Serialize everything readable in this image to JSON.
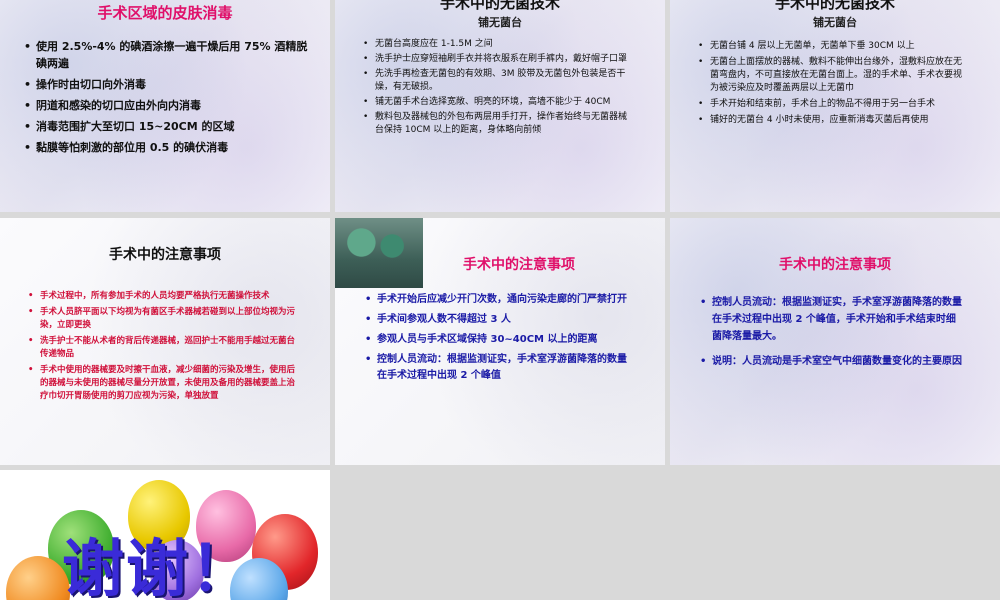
{
  "slide1": {
    "title": "手术区域的皮肤消毒",
    "bullets": [
      "使用 2.5%-4% 的碘酒涂擦一遍干燥后用 75% 酒精脱碘两遍",
      "操作时由切口向外消毒",
      "阴道和感染的切口应由外向内消毒",
      "消毒范围扩大至切口 15~20CM 的区域",
      "黏膜等怕刺激的部位用 0.5 的碘伏消毒"
    ]
  },
  "slide2": {
    "title": "手术中的无菌技术",
    "subtitle": "铺无菌台",
    "bullets": [
      "无菌台高度应在 1-1.5M 之间",
      "洗手护士应穿短袖刷手衣并将衣服系在刷手裤内，戴好帽子口罩",
      "先洗手再检查无菌包的有效期、3M 胶带及无菌包外包装是否干燥，有无破损。",
      "铺无菌手术台选择宽敞、明亮的环境，高墙不能少于 40CM",
      "敷料包及器械包的外包布两层用手打开，操作者始终与无菌器械台保持 10CM 以上的距离，身体略向前倾"
    ]
  },
  "slide3": {
    "title": "手术中的无菌技术",
    "subtitle": "铺无菌台",
    "bullets": [
      "无菌台铺 4 层以上无菌单，无菌单下垂 30CM 以上",
      "无菌台上面摆放的器械、敷料不能伸出台缘外，湿敷料应放在无菌弯盘内，不可直接放在无菌台面上。湿的手术单、手术衣要视为被污染应及时覆盖两层以上无菌巾",
      "手术开始和结束前，手术台上的物品不得用于另一台手术",
      "铺好的无菌台 4 小时未使用，应重新消毒灭菌后再使用"
    ]
  },
  "slide4": {
    "title": "手术中的注意事项",
    "bullets": [
      "手术过程中，所有参加手术的人员均要严格执行无菌操作技术",
      "手术人员脐平面以下均视为有菌区手术器械若碰到以上部位均视为污染，立即更换",
      "洗手护士不能从术者的背后传递器械，巡回护士不能用手越过无菌台传递物品",
      "手术中使用的器械要及时擦干血液，减少细菌的污染及增生，使用后的器械与未使用的器械尽量分开放置，未使用及备用的器械要盖上治疗巾切开胃肠使用的剪刀应视为污染，单独放置"
    ]
  },
  "slide5": {
    "title": "手术中的注意事项",
    "bullets": [
      "手术开始后应减少开门次数，通向污染走廊的门严禁打开",
      "手术间参观人数不得超过 3 人",
      "参观人员与手术区域保持 30~40CM 以上的距离",
      "控制人员流动：根据监测证实，手术室浮游菌降落的数量在手术过程中出现 2 个峰值"
    ]
  },
  "slide6": {
    "title": "手术中的注意事项",
    "bullets": [
      "控制人员流动：根据监测证实，手术室浮游菌降落的数量在手术过程中出现 2 个峰值，手术开始和手术结束时细菌降落量最大。",
      "说明：人员流动是手术室空气中细菌数量变化的主要原因"
    ]
  },
  "slide7": {
    "thanks": "谢谢！"
  },
  "colors": {
    "pink_title": "#e0106a",
    "blue_text": "#1a1aa6",
    "red_text": "#d0103a"
  }
}
